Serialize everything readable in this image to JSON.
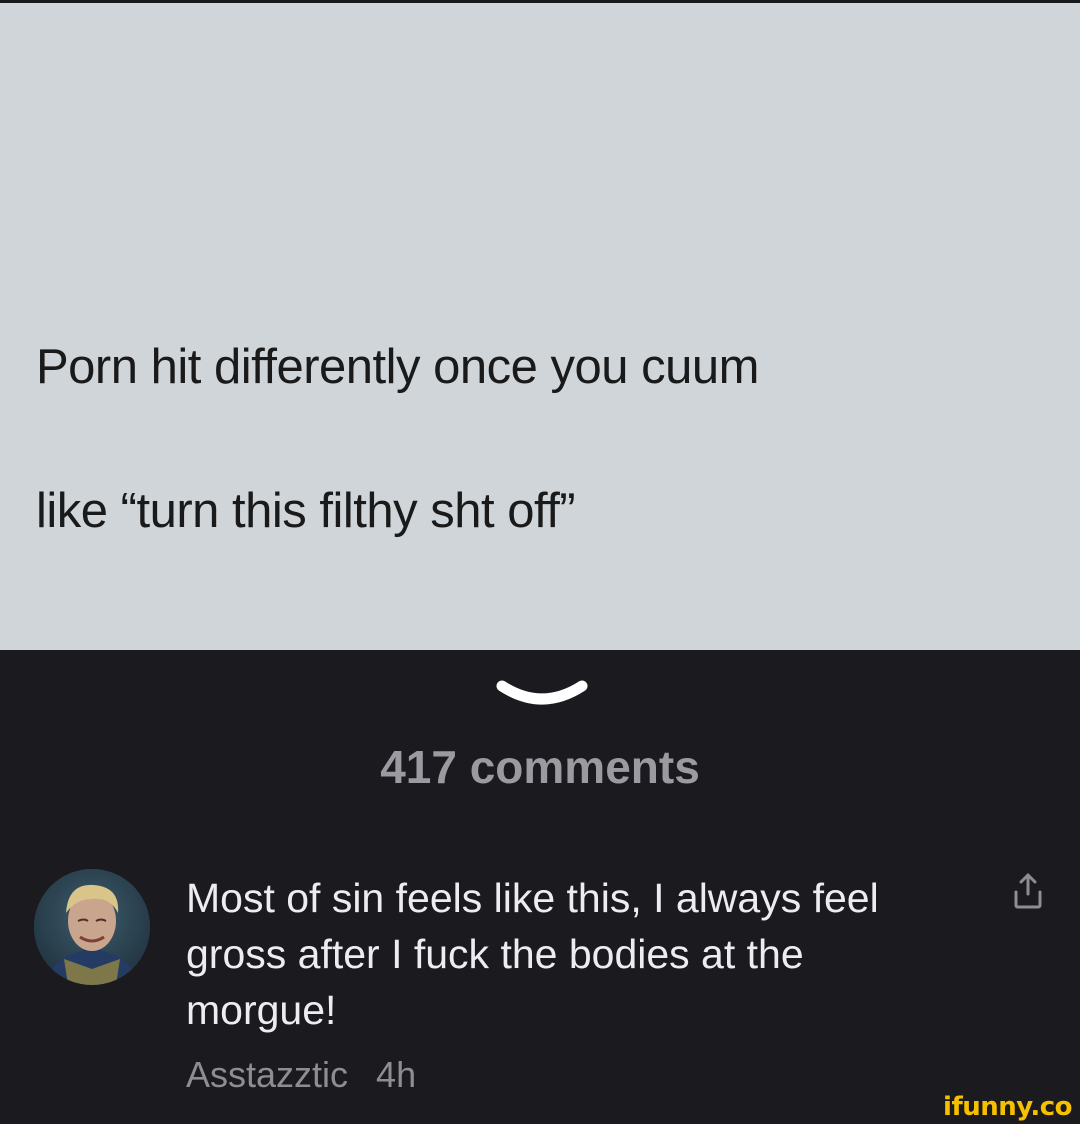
{
  "post": {
    "line1": "Porn hit differently once you cuum",
    "line2": "like “turn this filthy sht off”",
    "background_color": "#d0d5d9"
  },
  "comments": {
    "collapse_icon": "chevron-down-icon",
    "count_label": "417 comments",
    "items": [
      {
        "text": "Most of sin feels like this, I always feel gross after I fuck the bodies at the morgue!",
        "author": "Asstazztic",
        "time": "4h",
        "avatar_icon": "user-avatar",
        "action_icon": "share-icon"
      }
    ]
  },
  "watermark": {
    "text": "ifunny.co",
    "color": "#f6c000"
  },
  "theme": {
    "panel_background": "#1b1a1f",
    "comment_text_color": "#ededf0",
    "meta_text_color": "#8d8d93"
  }
}
